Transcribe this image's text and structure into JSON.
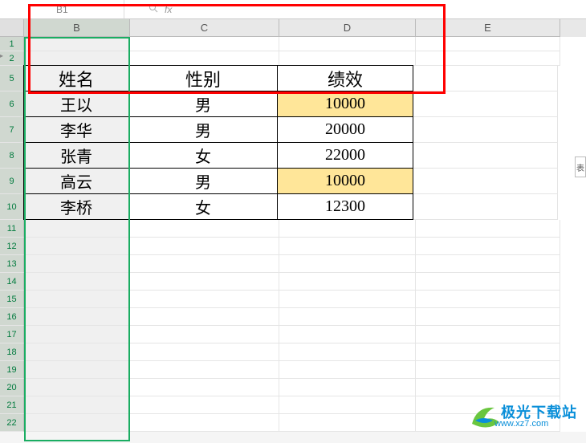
{
  "formula_bar": {
    "cell_ref": "B1",
    "fx_label": "fx"
  },
  "columns": [
    "B",
    "C",
    "D",
    "E"
  ],
  "selected_column": "B",
  "row_numbers": [
    1,
    2,
    5,
    6,
    7,
    8,
    9,
    10,
    11,
    12,
    13,
    14,
    15,
    16,
    17,
    18,
    19,
    20,
    21,
    22
  ],
  "table": {
    "headers": {
      "name": "姓名",
      "gender": "性别",
      "score": "绩效"
    },
    "rows": [
      {
        "name": "王以",
        "gender": "男",
        "score": "10000",
        "highlighted": true
      },
      {
        "name": "李华",
        "gender": "男",
        "score": "20000",
        "highlighted": false
      },
      {
        "name": "张青",
        "gender": "女",
        "score": "22000",
        "highlighted": false
      },
      {
        "name": "高云",
        "gender": "男",
        "score": "10000",
        "highlighted": true
      },
      {
        "name": "李桥",
        "gender": "女",
        "score": "12300",
        "highlighted": false
      }
    ]
  },
  "side_button": "表",
  "watermark": {
    "brand": "极光下载站",
    "url": "www.xz7.com"
  },
  "colors": {
    "highlight_cell": "#ffe699",
    "selection_border": "#1aad62",
    "annotation_red": "#ff0000"
  }
}
